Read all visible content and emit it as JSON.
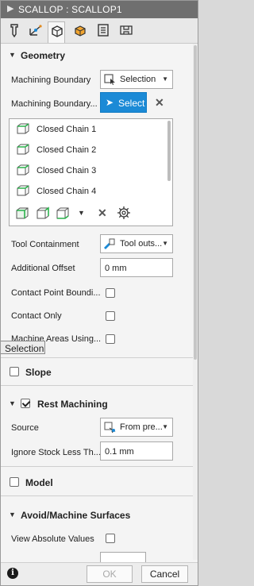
{
  "title": {
    "arrow": "▶",
    "text": "SCALLOP : SCALLOP1"
  },
  "tabs": [
    {
      "name": "tool-tab-icon"
    },
    {
      "name": "geometry-tab-icon"
    },
    {
      "name": "heights-tab-icon"
    },
    {
      "name": "passes-tab-icon"
    },
    {
      "name": "linking-tab-icon"
    },
    {
      "name": "post-tab-icon"
    }
  ],
  "geometry": {
    "header": "Geometry",
    "boundary_label": "Machining Boundary",
    "boundary_value": "Selection",
    "boundary_select_label": "Machining Boundary...",
    "select_button": "Select",
    "chains": [
      "Closed Chain 1",
      "Closed Chain 2",
      "Closed Chain 3",
      "Closed Chain 4"
    ],
    "tool_containment_label": "Tool Containment",
    "tool_containment_value": "Tool outs...",
    "additional_offset_label": "Additional Offset",
    "additional_offset_value": "0 mm",
    "contact_point_label": "Contact Point Boundi...",
    "contact_only_label": "Contact Only",
    "machine_areas_label": "Machine Areas Using..."
  },
  "tooltip": "Selection",
  "slope": {
    "header": "Slope",
    "checked": false
  },
  "rest": {
    "header": "Rest Machining",
    "checked": true,
    "source_label": "Source",
    "source_value": "From pre...",
    "ignore_label": "Ignore Stock Less Th...",
    "ignore_value": "0.1 mm"
  },
  "model": {
    "header": "Model",
    "checked": false
  },
  "avoid": {
    "header": "Avoid/Machine Surfaces",
    "view_abs_label": "View Absolute Values"
  },
  "footer": {
    "ok": "OK",
    "cancel": "Cancel",
    "info": "i"
  }
}
